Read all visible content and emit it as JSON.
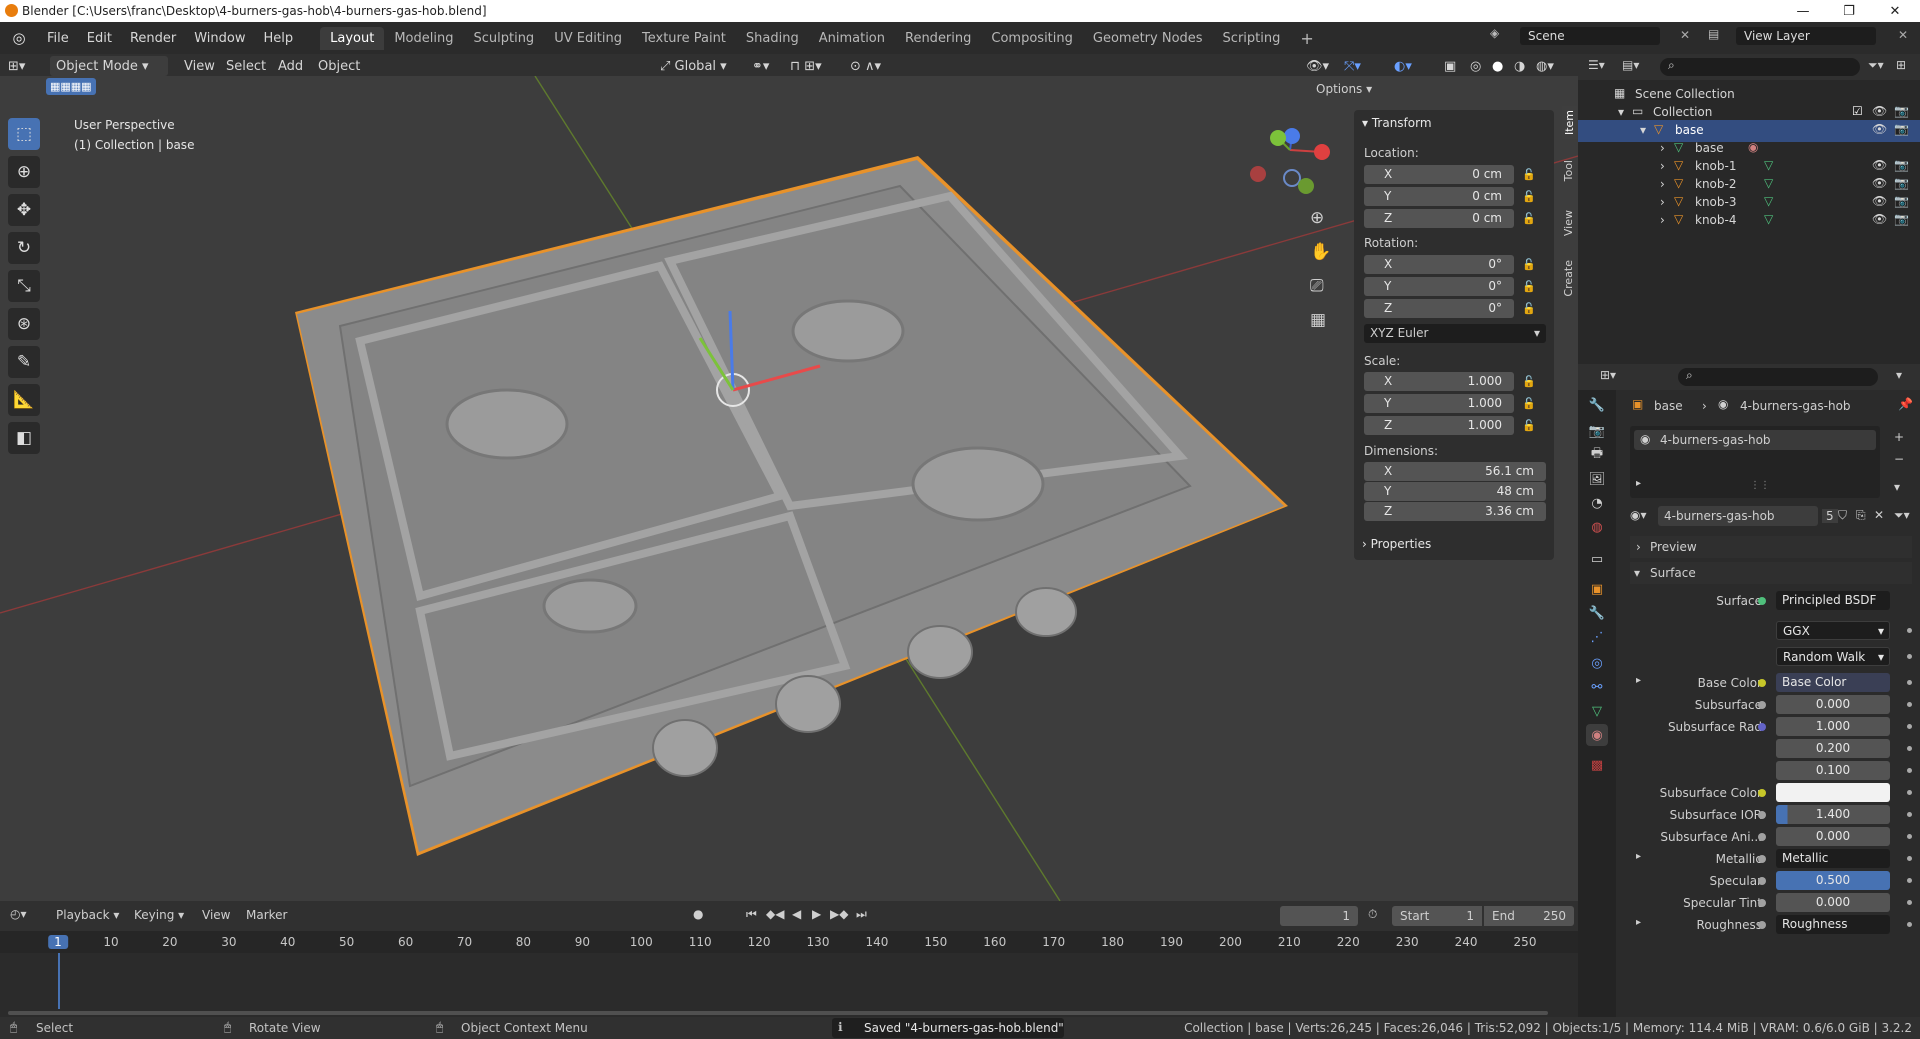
{
  "window": {
    "title": "Blender [C:\\Users\\franc\\Desktop\\4-burners-gas-hob\\4-burners-gas-hob.blend]"
  },
  "menu": [
    "File",
    "Edit",
    "Render",
    "Window",
    "Help"
  ],
  "workspaces": [
    "Layout",
    "Modeling",
    "Sculpting",
    "UV Editing",
    "Texture Paint",
    "Shading",
    "Animation",
    "Rendering",
    "Compositing",
    "Geometry Nodes",
    "Scripting"
  ],
  "active_workspace": "Layout",
  "scene": "Scene",
  "view_layer": "View Layer",
  "viewport_header": {
    "mode": "Object Mode",
    "view": "View",
    "select": "Select",
    "add": "Add",
    "object": "Object",
    "transform_orientation": "Global",
    "options": "Options"
  },
  "viewport": {
    "perspective": "User Perspective",
    "collection_info": "(1) Collection | base"
  },
  "npanel": {
    "tabs": [
      "Item",
      "Tool",
      "View",
      "Create"
    ],
    "transform_title": "Transform",
    "location_label": "Location:",
    "location": [
      {
        "axis": "X",
        "value": "0 cm"
      },
      {
        "axis": "Y",
        "value": "0 cm"
      },
      {
        "axis": "Z",
        "value": "0 cm"
      }
    ],
    "rotation_label": "Rotation:",
    "rotation": [
      {
        "axis": "X",
        "value": "0°"
      },
      {
        "axis": "Y",
        "value": "0°"
      },
      {
        "axis": "Z",
        "value": "0°"
      }
    ],
    "rotation_mode": "XYZ Euler",
    "scale_label": "Scale:",
    "scale": [
      {
        "axis": "X",
        "value": "1.000"
      },
      {
        "axis": "Y",
        "value": "1.000"
      },
      {
        "axis": "Z",
        "value": "1.000"
      }
    ],
    "dimensions_label": "Dimensions:",
    "dimensions": [
      {
        "axis": "X",
        "value": "56.1 cm"
      },
      {
        "axis": "Y",
        "value": "48 cm"
      },
      {
        "axis": "Z",
        "value": "3.36 cm"
      }
    ],
    "properties_title": "Properties"
  },
  "outliner": {
    "scene_collection": "Scene Collection",
    "collection": "Collection",
    "items": [
      {
        "name": "base",
        "level": 2,
        "selected": true
      },
      {
        "name": "base",
        "level": 3,
        "selected": false
      },
      {
        "name": "knob-1",
        "level": 3,
        "selected": false
      },
      {
        "name": "knob-2",
        "level": 3,
        "selected": false
      },
      {
        "name": "knob-3",
        "level": 3,
        "selected": false
      },
      {
        "name": "knob-4",
        "level": 3,
        "selected": false
      }
    ]
  },
  "properties": {
    "breadcrumb_object": "base",
    "breadcrumb_material": "4-burners-gas-hob",
    "slot": "4-burners-gas-hob",
    "material_name": "4-burners-gas-hob",
    "users": "5",
    "preview": "Preview",
    "surface_header": "Surface",
    "surface_label": "Surface",
    "surface_value": "Principled BSDF",
    "distribution": "GGX",
    "subsurface_method": "Random Walk",
    "rows": [
      {
        "label": "Base Color",
        "value": "Base Color",
        "kind": "link",
        "dot": "#c7c729"
      },
      {
        "label": "Subsurface",
        "value": "0.000",
        "kind": "num",
        "dot": "#a1a1a1"
      },
      {
        "label": "Subsurface Rad",
        "value": "1.000",
        "kind": "num",
        "dot": "#6363c7"
      },
      {
        "label": "",
        "value": "0.200",
        "kind": "num",
        "dot": ""
      },
      {
        "label": "",
        "value": "0.100",
        "kind": "num",
        "dot": ""
      },
      {
        "label": "Subsurface Color",
        "value": "",
        "kind": "color",
        "dot": "#c7c729"
      },
      {
        "label": "Subsurface IOR",
        "value": "1.400",
        "kind": "num",
        "dot": "#a1a1a1"
      },
      {
        "label": "Subsurface Ani...",
        "value": "0.000",
        "kind": "num",
        "dot": "#a1a1a1"
      },
      {
        "label": "Metallic",
        "value": "Metallic",
        "kind": "link",
        "dot": "#a1a1a1"
      },
      {
        "label": "Specular",
        "value": "0.500",
        "kind": "num",
        "dot": "#a1a1a1"
      },
      {
        "label": "Specular Tint",
        "value": "0.000",
        "kind": "num",
        "dot": "#a1a1a1"
      },
      {
        "label": "Roughness",
        "value": "Roughness",
        "kind": "link",
        "dot": "#a1a1a1"
      }
    ]
  },
  "timeline": {
    "menus": [
      "Playback",
      "Keying",
      "View",
      "Marker"
    ],
    "current_frame": "1",
    "start_label": "Start",
    "start": "1",
    "end_label": "End",
    "end": "250",
    "ticks": [
      "1",
      "10",
      "20",
      "30",
      "40",
      "50",
      "60",
      "70",
      "80",
      "90",
      "100",
      "110",
      "120",
      "130",
      "140",
      "150",
      "160",
      "170",
      "180",
      "190",
      "200",
      "210",
      "220",
      "230",
      "240",
      "250"
    ]
  },
  "status": {
    "select": "Select",
    "rotate": "Rotate View",
    "context": "Object Context Menu",
    "message": "Saved \"4-burners-gas-hob.blend\"",
    "stats": "Collection | base | Verts:26,245 | Faces:26,046 | Tris:52,092 | Objects:1/5 | Memory: 114.4 MiB | VRAM: 0.6/6.0 GiB | 3.2.2"
  },
  "colors": {
    "accent": "#4772b3",
    "selection": "#e8922a",
    "header": "#303030",
    "viewport": "#3d3d3d"
  }
}
